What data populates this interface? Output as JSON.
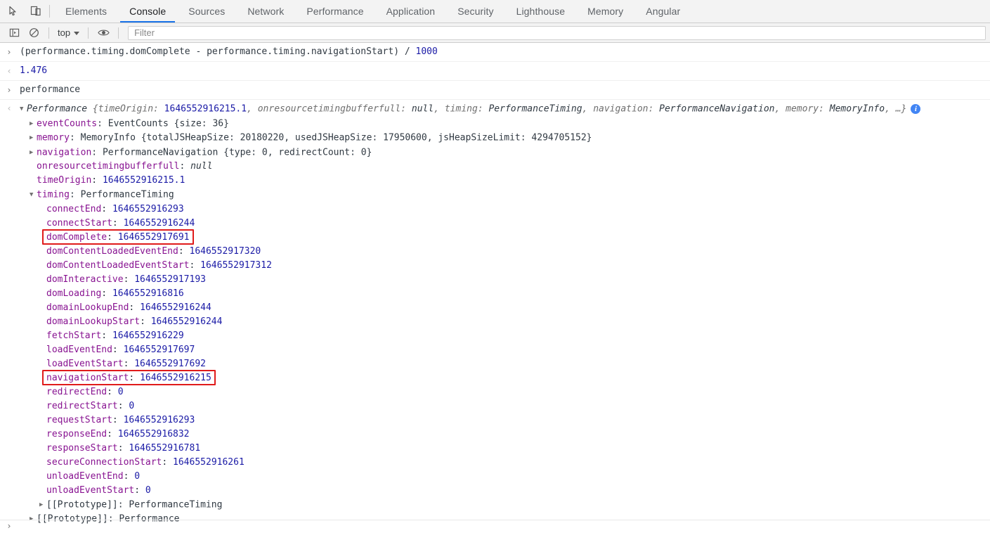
{
  "tabbar": {
    "icons": [
      {
        "name": "inspect-element-icon",
        "glyph": "inspect"
      },
      {
        "name": "device-toolbar-icon",
        "glyph": "device"
      }
    ],
    "tabs": [
      {
        "label": "Elements",
        "active": false
      },
      {
        "label": "Console",
        "active": true
      },
      {
        "label": "Sources",
        "active": false
      },
      {
        "label": "Network",
        "active": false
      },
      {
        "label": "Performance",
        "active": false
      },
      {
        "label": "Application",
        "active": false
      },
      {
        "label": "Security",
        "active": false
      },
      {
        "label": "Lighthouse",
        "active": false
      },
      {
        "label": "Memory",
        "active": false
      },
      {
        "label": "Angular",
        "active": false
      }
    ]
  },
  "console_toolbar": {
    "sidebar_toggle_label": "console-sidebar-toggle",
    "clear_label": "clear-console",
    "context": "top",
    "eye_label": "live-expressions",
    "filter_placeholder": "Filter",
    "filter_value": ""
  },
  "console": {
    "command": {
      "prompt": "›",
      "expr_text": "(performance.timing.domComplete - performance.timing.navigationStart) / ",
      "expr_num": "1000"
    },
    "result": {
      "prompt": "‹",
      "value": "1.476"
    },
    "command2": {
      "prompt": "›",
      "expr_text": "performance"
    },
    "object": {
      "prompt": "‹",
      "class_name": "Performance",
      "preview": {
        "open": " {",
        "parts": [
          {
            "key": "timeOrigin",
            "value": "1646552916215.1",
            "type": "num"
          },
          {
            "key": "onresourcetimingbufferfull",
            "value": "null",
            "type": "null"
          },
          {
            "key": "timing",
            "value": "PerformanceTiming",
            "type": "cls"
          },
          {
            "key": "navigation",
            "value": "PerformanceNavigation",
            "type": "cls"
          },
          {
            "key": "memory",
            "value": "MemoryInfo",
            "type": "cls"
          }
        ],
        "close": ", …}"
      },
      "info_badge": "i",
      "props": [
        {
          "indent": 1,
          "arrow": "closed",
          "key": "eventCounts",
          "sep": ": ",
          "value": "EventCounts {size: 36}",
          "vtype": "cls-preview"
        },
        {
          "indent": 1,
          "arrow": "closed",
          "key": "memory",
          "sep": ": ",
          "value": "MemoryInfo {totalJSHeapSize: 20180220, usedJSHeapSize: 17950600, jsHeapSizeLimit: 4294705152}",
          "vtype": "cls-preview"
        },
        {
          "indent": 1,
          "arrow": "closed",
          "key": "navigation",
          "sep": ": ",
          "value": "PerformanceNavigation {type: 0, redirectCount: 0}",
          "vtype": "cls-preview"
        },
        {
          "indent": 1,
          "arrow": "none",
          "key": "onresourcetimingbufferfull",
          "sep": ": ",
          "value": "null",
          "vtype": "null"
        },
        {
          "indent": 1,
          "arrow": "none",
          "key": "timeOrigin",
          "sep": ": ",
          "value": "1646552916215.1",
          "vtype": "num"
        },
        {
          "indent": 1,
          "arrow": "open",
          "key": "timing",
          "sep": ": ",
          "value": "PerformanceTiming",
          "vtype": "plain"
        },
        {
          "indent": 2,
          "arrow": "none",
          "key": "connectEnd",
          "sep": ": ",
          "value": "1646552916293",
          "vtype": "num"
        },
        {
          "indent": 2,
          "arrow": "none",
          "key": "connectStart",
          "sep": ": ",
          "value": "1646552916244",
          "vtype": "num"
        },
        {
          "indent": 2,
          "arrow": "none",
          "key": "domComplete",
          "sep": ": ",
          "value": "1646552917691",
          "vtype": "num",
          "highlight": true
        },
        {
          "indent": 2,
          "arrow": "none",
          "key": "domContentLoadedEventEnd",
          "sep": ": ",
          "value": "1646552917320",
          "vtype": "num"
        },
        {
          "indent": 2,
          "arrow": "none",
          "key": "domContentLoadedEventStart",
          "sep": ": ",
          "value": "1646552917312",
          "vtype": "num"
        },
        {
          "indent": 2,
          "arrow": "none",
          "key": "domInteractive",
          "sep": ": ",
          "value": "1646552917193",
          "vtype": "num"
        },
        {
          "indent": 2,
          "arrow": "none",
          "key": "domLoading",
          "sep": ": ",
          "value": "1646552916816",
          "vtype": "num"
        },
        {
          "indent": 2,
          "arrow": "none",
          "key": "domainLookupEnd",
          "sep": ": ",
          "value": "1646552916244",
          "vtype": "num"
        },
        {
          "indent": 2,
          "arrow": "none",
          "key": "domainLookupStart",
          "sep": ": ",
          "value": "1646552916244",
          "vtype": "num"
        },
        {
          "indent": 2,
          "arrow": "none",
          "key": "fetchStart",
          "sep": ": ",
          "value": "1646552916229",
          "vtype": "num"
        },
        {
          "indent": 2,
          "arrow": "none",
          "key": "loadEventEnd",
          "sep": ": ",
          "value": "1646552917697",
          "vtype": "num"
        },
        {
          "indent": 2,
          "arrow": "none",
          "key": "loadEventStart",
          "sep": ": ",
          "value": "1646552917692",
          "vtype": "num"
        },
        {
          "indent": 2,
          "arrow": "none",
          "key": "navigationStart",
          "sep": ": ",
          "value": "1646552916215",
          "vtype": "num",
          "highlight": true
        },
        {
          "indent": 2,
          "arrow": "none",
          "key": "redirectEnd",
          "sep": ": ",
          "value": "0",
          "vtype": "num"
        },
        {
          "indent": 2,
          "arrow": "none",
          "key": "redirectStart",
          "sep": ": ",
          "value": "0",
          "vtype": "num"
        },
        {
          "indent": 2,
          "arrow": "none",
          "key": "requestStart",
          "sep": ": ",
          "value": "1646552916293",
          "vtype": "num"
        },
        {
          "indent": 2,
          "arrow": "none",
          "key": "responseEnd",
          "sep": ": ",
          "value": "1646552916832",
          "vtype": "num"
        },
        {
          "indent": 2,
          "arrow": "none",
          "key": "responseStart",
          "sep": ": ",
          "value": "1646552916781",
          "vtype": "num"
        },
        {
          "indent": 2,
          "arrow": "none",
          "key": "secureConnectionStart",
          "sep": ": ",
          "value": "1646552916261",
          "vtype": "num"
        },
        {
          "indent": 2,
          "arrow": "none",
          "key": "unloadEventEnd",
          "sep": ": ",
          "value": "0",
          "vtype": "num"
        },
        {
          "indent": 2,
          "arrow": "none",
          "key": "unloadEventStart",
          "sep": ": ",
          "value": "0",
          "vtype": "num"
        },
        {
          "indent": 2,
          "arrow": "closed",
          "key": "[[Prototype]]",
          "sep": ": ",
          "value": "PerformanceTiming",
          "vtype": "plain",
          "proto": true
        },
        {
          "indent": 1,
          "arrow": "closed",
          "key": "[[Prototype]]",
          "sep": ": ",
          "value": "Performance",
          "vtype": "plain",
          "proto": true
        }
      ]
    },
    "final_prompt": "›"
  },
  "colors": {
    "accent": "#1a73e8",
    "property": "#881391",
    "number": "#1a1aa6",
    "highlight": "#e01b1b",
    "chrome_bg": "#f3f3f3"
  }
}
